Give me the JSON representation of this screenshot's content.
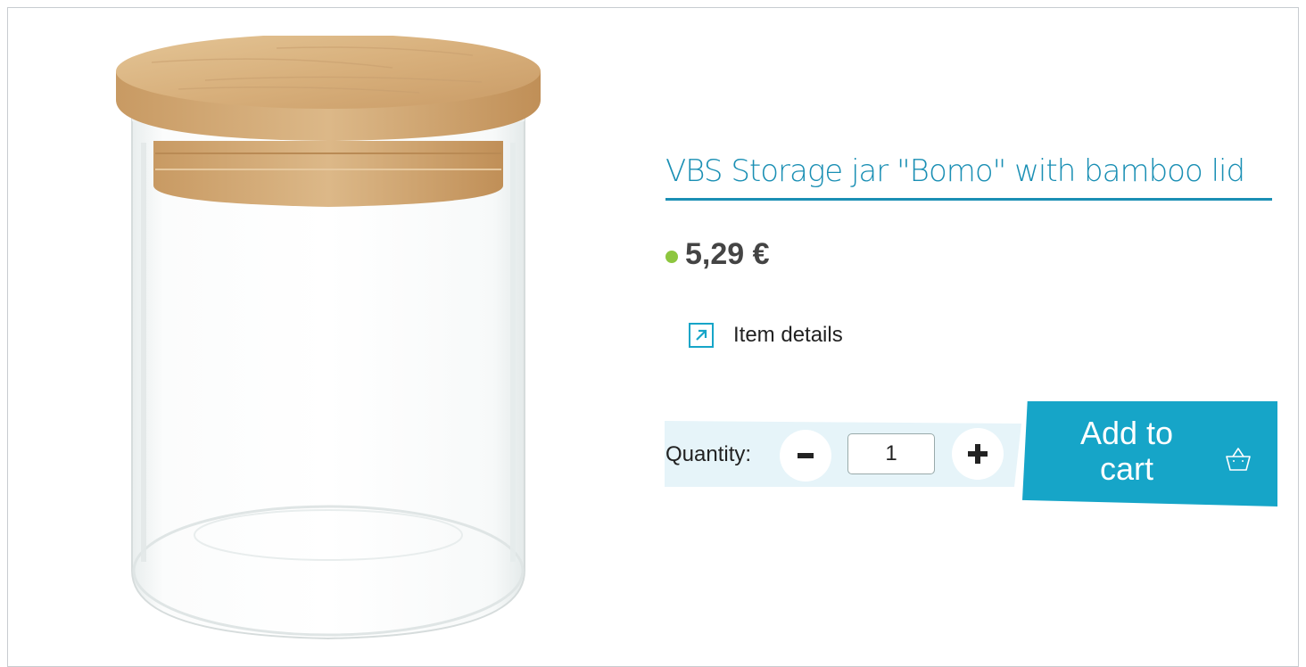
{
  "product": {
    "title": "VBS Storage jar \"Bomo\" with bamboo lid",
    "price": "5,29 €",
    "availability_color": "#8dc63f",
    "image_alt": "Glass storage jar with bamboo lid"
  },
  "details": {
    "label": "Item details",
    "icon": "external-link-icon"
  },
  "quantity": {
    "label": "Quantity:",
    "value": "1",
    "minus_icon": "minus-icon",
    "plus_icon": "plus-icon"
  },
  "cart": {
    "label": "Add to cart",
    "icon": "basket-icon"
  },
  "colors": {
    "accent": "#16a5c8",
    "link": "#1a8fb4",
    "quantity_bg": "#e6f4f9",
    "lid": "#d9b585"
  }
}
